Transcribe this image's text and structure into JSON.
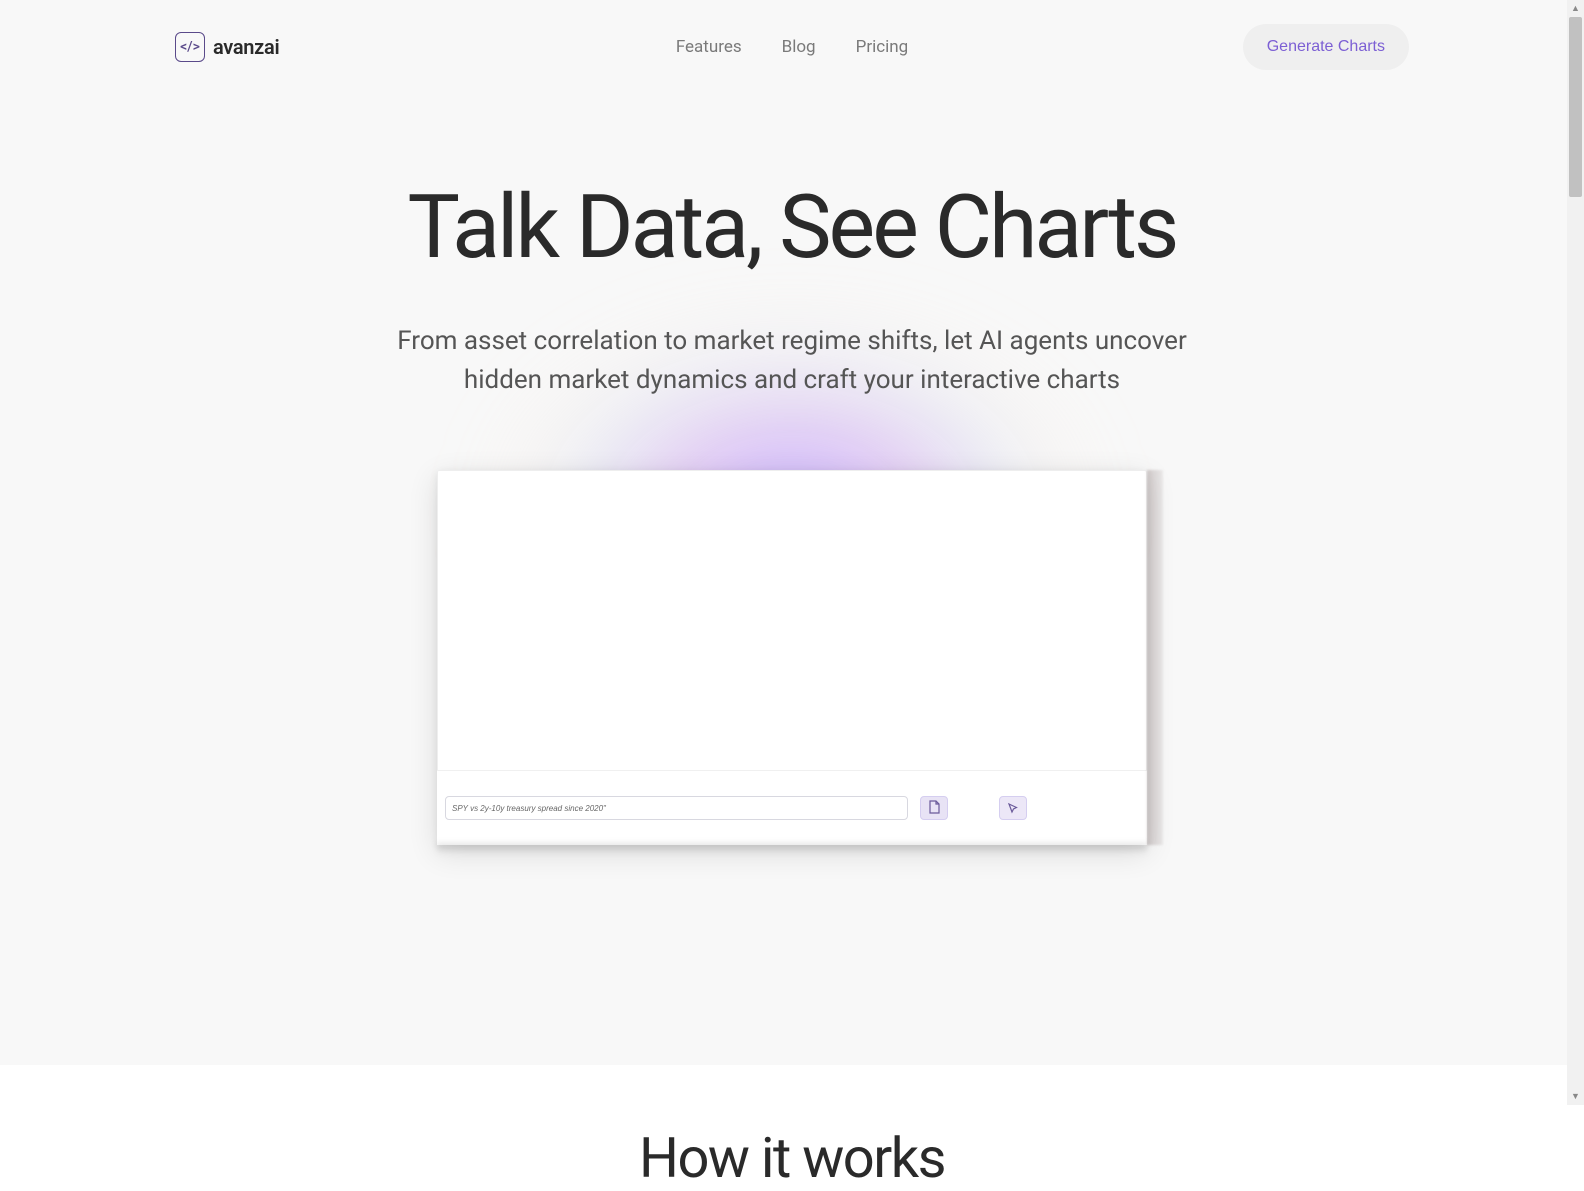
{
  "brand": {
    "name": "avanzai",
    "logo_glyph": "</>"
  },
  "nav": {
    "items": [
      {
        "label": "Features"
      },
      {
        "label": "Blog"
      },
      {
        "label": "Pricing"
      }
    ],
    "cta": "Generate Charts"
  },
  "hero": {
    "title": "Talk Data, See Charts",
    "subtitle": "From asset correlation to market regime shifts, let AI agents uncover hidden market dynamics and craft your interactive charts"
  },
  "preview": {
    "input_text": "SPY vs 2y-10y treasury spread since 2020\"",
    "attach_icon": "🗎",
    "send_icon": "➤"
  },
  "section2": {
    "title": "How it works"
  }
}
